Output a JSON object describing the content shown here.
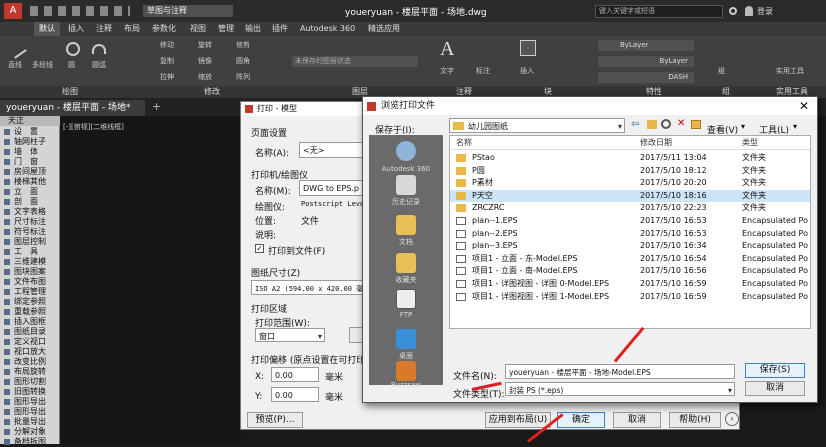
{
  "app": {
    "title": "youeryuan - 楼层平面 - 场地.dwg",
    "workspace": "草图与注释",
    "search_placeholder": "键入关键字或短语",
    "login": "登录"
  },
  "ribbon": {
    "tabs": [
      "默认",
      "插入",
      "注释",
      "布局",
      "参数化",
      "视图",
      "管理",
      "输出",
      "插件",
      "Autodesk 360",
      "精选应用"
    ],
    "tools": [
      "直线",
      "多段线",
      "圆",
      "圆弧",
      "移动",
      "旋转",
      "修剪",
      "复制",
      "镜像",
      "圆角",
      "拉伸",
      "缩放",
      "阵列",
      "文字",
      "标注",
      "图层",
      "插入",
      "编辑",
      "特性",
      "匹配",
      "组",
      "实用工具"
    ],
    "layer_state": "未保存的图层状态",
    "bylayer1": "ByLayer",
    "bylayer2": "ByLayer",
    "dash": "DASH",
    "panels": [
      "绘图",
      "修改",
      "图层",
      "注释",
      "块",
      "特性",
      "组",
      "实用工具"
    ]
  },
  "doc_tab": "youeryuan - 楼层平面 - 场地*",
  "canvas_label": "[-][俯视][二维线框]",
  "palette": {
    "header": "天正",
    "items": [
      "设　置",
      "轴网柱子",
      "墙　体",
      "门　窗",
      "房间屋顶",
      "楼梯其他",
      "立　面",
      "剖　面",
      "文字表格",
      "尺寸标注",
      "符号标注",
      "图层控制",
      "工　具",
      "三维建模",
      "图块图案",
      "文件布图",
      "工程管理",
      "绑定参照",
      "重载参照",
      "插入图框",
      "图纸目录",
      "定义视口",
      "视口放大",
      "改变比例",
      "布局旋转",
      "图形切割",
      "旧图转换",
      "图形导出",
      "图形导出",
      "批量导出",
      "分解对象",
      "备档拆图"
    ]
  },
  "plot": {
    "title": "打印 - 模型",
    "page_setup": "页面设置",
    "name_label": "名称(A):",
    "name_value": "<无>",
    "printer_section": "打印机/绘图仪",
    "printer_name_label": "名称(M):",
    "printer_value": "DWG to EPS.p",
    "plotter_label": "绘图仪:",
    "plotter_value": "Postscript Leve",
    "location_label": "位置:",
    "location_value": "文件",
    "desc_label": "说明:",
    "print_to_file": "打印到文件(F)",
    "paper_size_label": "图纸尺寸(Z)",
    "paper_size_value": "ISO A2 (594.00 x 420.00 毫",
    "area_section": "打印区域",
    "area_range_label": "打印范围(W):",
    "area_range_value": "窗口",
    "offset_section": "打印偏移 (原点设置在可打印区",
    "x_label": "X:",
    "x_value": "0.00",
    "y_label": "Y:",
    "y_value": "0.00",
    "unit_mm": "毫米",
    "preview": "预览(P)...",
    "apply_layout": "应用到布局(U)",
    "ok": "确定",
    "cancel": "取消",
    "help": "帮助(H)"
  },
  "browse": {
    "title": "浏览打印文件",
    "save_in_label": "保存于(I):",
    "save_in_value": "幼儿园图纸",
    "view_label": "查看(V)",
    "tools_label": "工具(L)",
    "places": [
      "Autodesk 360",
      "历史记录",
      "文档",
      "收藏夹",
      "FTP",
      "桌面",
      "Buzzsaw"
    ],
    "columns": [
      "名称",
      "修改日期",
      "类型"
    ],
    "files": [
      {
        "name": "PStao",
        "date": "2017/5/11 13:04",
        "type": "文件夹",
        "kind": "folder"
      },
      {
        "name": "P圆",
        "date": "2017/5/10 18:12",
        "type": "文件夹",
        "kind": "folder"
      },
      {
        "name": "P素材",
        "date": "2017/5/10 20:20",
        "type": "文件夹",
        "kind": "folder"
      },
      {
        "name": "P天空",
        "date": "2017/5/10 18:16",
        "type": "文件夹",
        "kind": "folder"
      },
      {
        "name": "ZRCZRC",
        "date": "2017/5/10 22:23",
        "type": "文件夹",
        "kind": "folder"
      },
      {
        "name": "plan--1.EPS",
        "date": "2017/5/10 16:53",
        "type": "Encapsulated Po",
        "kind": "eps"
      },
      {
        "name": "plan--2.EPS",
        "date": "2017/5/10 16:53",
        "type": "Encapsulated Po",
        "kind": "eps"
      },
      {
        "name": "plan--3.EPS",
        "date": "2017/5/10 16:34",
        "type": "Encapsulated Po",
        "kind": "eps"
      },
      {
        "name": "项目1 - 立面 - 东-Model.EPS",
        "date": "2017/5/10 16:54",
        "type": "Encapsulated Po",
        "kind": "eps"
      },
      {
        "name": "项目1 - 立面 - 南-Model.EPS",
        "date": "2017/5/10 16:56",
        "type": "Encapsulated Po",
        "kind": "eps"
      },
      {
        "name": "项目1 - 详图视图 - 详图 0-Model.EPS",
        "date": "2017/5/10 16:59",
        "type": "Encapsulated Po",
        "kind": "eps"
      },
      {
        "name": "项目1 - 详图视图 - 详图 1-Model.EPS",
        "date": "2017/5/10 16:59",
        "type": "Encapsulated Po",
        "kind": "eps"
      }
    ],
    "selected_row": 3,
    "filename_label": "文件名(N):",
    "filename_value": "youeryuan - 楼层平面 - 场地-Model.EPS",
    "filetype_label": "文件类型(T):",
    "filetype_value": "封装 PS (*.eps)",
    "save": "保存(S)",
    "cancel": "取消"
  }
}
